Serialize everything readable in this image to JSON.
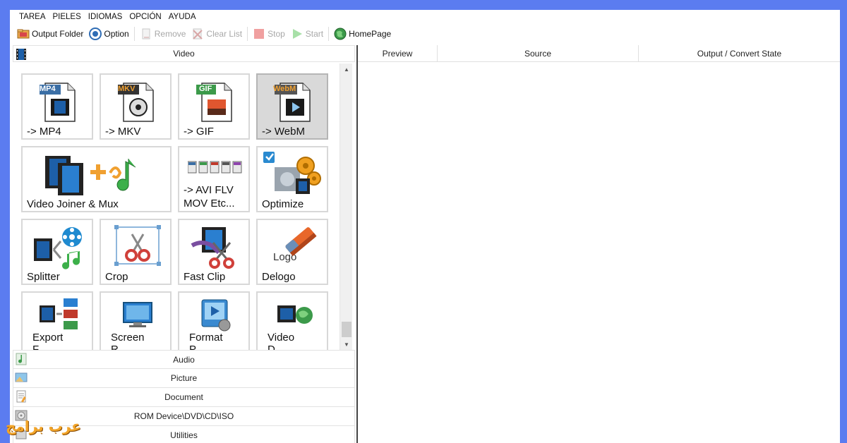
{
  "menu": [
    "TAREA",
    "PIELES",
    "IDIOMAS",
    "OPCIÓN",
    "AYUDA"
  ],
  "toolbar": {
    "output_folder": "Output Folder",
    "option": "Option",
    "remove": "Remove",
    "clear_list": "Clear List",
    "stop": "Stop",
    "start": "Start",
    "homepage": "HomePage"
  },
  "video_section": {
    "label": "Video"
  },
  "tiles": [
    {
      "label": "-> MP4",
      "badge": "MP4",
      "icon": "mp4-file-icon"
    },
    {
      "label": "-> MKV",
      "badge": "MKV",
      "icon": "mkv-file-icon"
    },
    {
      "label": "-> GIF",
      "badge": "GIF",
      "icon": "gif-file-icon"
    },
    {
      "label": "-> WebM",
      "badge": "WebM",
      "icon": "webm-file-icon"
    },
    {
      "label": "Video Joiner & Mux",
      "icon": "video-joiner-icon"
    },
    {
      "label": "-> AVI FLV\nMOV Etc...",
      "icon": "multi-format-icon"
    },
    {
      "label": "Optimize",
      "icon": "optimize-gears-icon"
    },
    {
      "label": "Splitter",
      "icon": "splitter-icon"
    },
    {
      "label": "Crop",
      "icon": "crop-scissors-icon"
    },
    {
      "label": "Fast Clip",
      "icon": "fast-clip-icon"
    },
    {
      "label": "Delogo",
      "logo_text": "Logo",
      "icon": "eraser-icon"
    },
    {
      "label": "Export\nF",
      "icon": "export-frames-icon"
    },
    {
      "label": "Screen\nR",
      "icon": "screen-record-icon"
    },
    {
      "label": "Format\nP",
      "icon": "format-player-icon"
    },
    {
      "label": "Video\nD",
      "icon": "video-download-icon"
    }
  ],
  "categories": [
    {
      "label": "Audio",
      "icon": "music-note-icon"
    },
    {
      "label": "Picture",
      "icon": "picture-icon"
    },
    {
      "label": "Document",
      "icon": "document-icon"
    },
    {
      "label": "ROM Device\\DVD\\CD\\ISO",
      "icon": "disc-icon"
    },
    {
      "label": "Utilities",
      "icon": "utilities-icon"
    }
  ],
  "table": {
    "columns": [
      "Preview",
      "Source",
      "Output / Convert State"
    ]
  },
  "watermark": "عرب برامج",
  "colors": {
    "frame": "#5b7cf0",
    "mp4_badge": "#3a6ea5",
    "mkv_badge": "#333333",
    "gif_badge": "#3c9a4a",
    "webm_badge": "#555555",
    "disabled_text": "#a8a8a8"
  }
}
